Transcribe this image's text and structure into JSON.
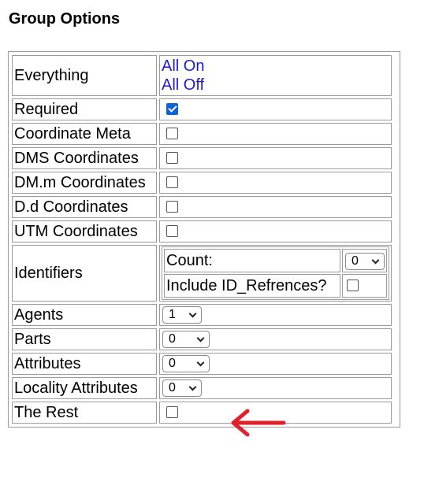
{
  "page": {
    "title": "Group Options"
  },
  "everything": {
    "label": "Everything",
    "all_on": "All On",
    "all_off": "All Off",
    "link_color": "#1a1ad0"
  },
  "rows": {
    "required": {
      "label": "Required",
      "checked": true
    },
    "coordinate_meta": {
      "label": "Coordinate Meta",
      "checked": false
    },
    "dms_coordinates": {
      "label": "DMS Coordinates",
      "checked": false
    },
    "dmm_coordinates": {
      "label": "DM.m Coordinates",
      "checked": false
    },
    "dd_coordinates": {
      "label": "D.d Coordinates",
      "checked": false
    },
    "utm_coordinates": {
      "label": "UTM Coordinates",
      "checked": false
    },
    "identifiers": {
      "label": "Identifiers",
      "count_label": "Count:",
      "count_value": "0",
      "include_label": "Include ID_Refrences?",
      "include_checked": false
    },
    "agents": {
      "label": "Agents",
      "value": "1"
    },
    "parts": {
      "label": "Parts",
      "value": "0"
    },
    "attributes": {
      "label": "Attributes",
      "value": "0"
    },
    "locality_attributes": {
      "label": "Locality Attributes",
      "value": "0"
    },
    "the_rest": {
      "label": "The Rest",
      "checked": false
    }
  },
  "annotation": {
    "arrow_color": "#e0202a",
    "arrow_icon": "red-left-arrow-icon"
  },
  "colors": {
    "checkbox_checked": "#0b63d6",
    "border": "#9a9a9a"
  }
}
